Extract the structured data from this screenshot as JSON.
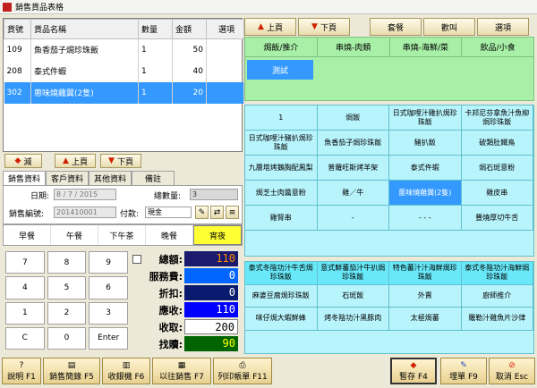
{
  "window": {
    "title": "銷售貨品表格"
  },
  "order_table": {
    "headers": [
      "貨號",
      "貨品名稱",
      "數量",
      "金額",
      "選項"
    ],
    "rows": [
      {
        "code": "109",
        "name": "魚香茄子焗珍珠飯",
        "qty": "1",
        "amount": "50",
        "option": ""
      },
      {
        "code": "208",
        "name": "泰式件蝦",
        "qty": "1",
        "amount": "40",
        "option": ""
      },
      {
        "code": "302",
        "name": "蔥味燒雞翼(2隻)",
        "qty": "1",
        "amount": "20",
        "option": ""
      }
    ]
  },
  "left_toolbar": {
    "minus": "減",
    "up": "上頁",
    "down": "下頁"
  },
  "tabs": [
    "銷售資料",
    "客戶資料",
    "其他資料",
    "備註"
  ],
  "form": {
    "date_label": "日期:",
    "date_value": "8 / 7 / 2015",
    "total_qty_label": "總數量:",
    "total_qty_value": "3",
    "invoice_label": "銷售編號:",
    "invoice_value": "201410001",
    "payment_label": "付款:",
    "payment_value": "現金"
  },
  "meals": [
    "早餐",
    "午餐",
    "下午茶",
    "晚餐",
    "宵夜"
  ],
  "keypad": [
    "7",
    "8",
    "9",
    "4",
    "5",
    "6",
    "1",
    "2",
    "3",
    "C",
    "0",
    "Enter"
  ],
  "totals": {
    "total_label": "總額:",
    "total_value": "110",
    "service_label": "服務費:",
    "service_value": "0",
    "discount_label": "折扣:",
    "discount_value": "0",
    "receivable_label": "應收:",
    "receivable_value": "110",
    "received_label": "收取:",
    "received_value": "200",
    "change_label": "找贖:",
    "change_value": "90"
  },
  "right_toolbar": {
    "up": "上頁",
    "down": "下頁",
    "set": "套餐",
    "call": "歡叫",
    "option": "選項"
  },
  "categories": [
    "焗飯/推介",
    "串燒-肉類",
    "串燒-海鮮/菜",
    "飲品/小食"
  ],
  "subcategory": "測試",
  "items1": [
    "1",
    "焗飯",
    "日式咖哩汁雞扒焗珍珠飯",
    "卡邦尼芬拿魚汁魚柳焗珍珠飯",
    "日式咖哩汁豬扒焗珍珠飯",
    "魚香茄子焗珍珠飯",
    "豬扒飯",
    "破類肚鐵鳥",
    "九層塔烤鵝胸配鳳梨",
    "普羅旺斯烤羊架",
    "泰式件蝦",
    "焗石斑意粉",
    "焗芝士肉醬意粉",
    "雞／牛",
    "蔥味燒雞翼(2隻)",
    "雞皮串",
    "雞腎串",
    "-",
    "- - -",
    "豐燒厚切牛舌"
  ],
  "items2": [
    "泰式冬陰功汁牛舌焗珍珠飯",
    "意式鮮蕃茄汁牛扒焗珍珠飯",
    "特色蕃汁汁海鮮焗珍珠飯",
    "泰式冬陰功汁海鮮焗珍珠飯",
    "麻婆豆腐焗珍珠飯",
    "石斑飯",
    "外賣",
    "廚師推介",
    "味仔焗大蝦鮮蜂",
    "烤冬陰功汁黑豚肉",
    "太極焗蕃",
    "羅勒汁雞魚片沙律"
  ],
  "bottom_bar": {
    "help": "說明 F1",
    "sales_record": "銷售簡錄 F5",
    "collect": "收銀機 F6",
    "previous": "以往銷售 F7",
    "print_bill": "列印帳單 F11",
    "hold": "暫存 F4",
    "submit": "埋單 F9",
    "cancel": "取消 Esc"
  },
  "colors": {
    "selection": "#3399ff",
    "green_panel": "#a8f0a8",
    "cyan_panel": "#b8f4fc"
  }
}
